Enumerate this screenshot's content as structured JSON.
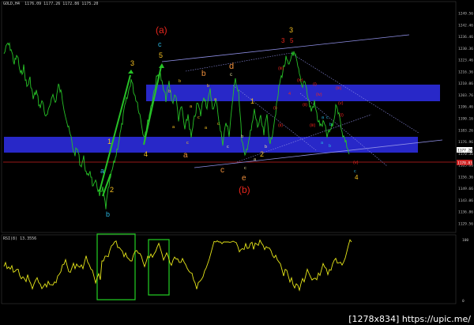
{
  "header": {
    "symbol_info": "GOLD,H4  1176.09 1177.26 1172.86 1175.20"
  },
  "rsi": {
    "title": "RSI(8) 13.3556",
    "levels": [
      "100",
      "0"
    ]
  },
  "price_axis": {
    "labels": [
      "1249.56",
      "1242.46",
      "1236.46",
      "1230.36",
      "1223.46",
      "1216.36",
      "1210.06",
      "1203.76",
      "1196.46",
      "1190.16",
      "1183.26",
      "1176.96",
      "1170.36",
      "1163.86",
      "1156.36",
      "1149.66",
      "1143.06",
      "1136.86",
      "1129.56"
    ],
    "bid_tag": "1177.26",
    "ask_tag": "1170.83"
  },
  "labels": {
    "a_cycle": "(a)",
    "b_cycle": "(b)",
    "c_cyan": "c",
    "five_top": "5",
    "three_left": "3",
    "one": "1",
    "two": "2",
    "a_cyan": "a",
    "b_cyan": "b",
    "four_left": "4",
    "three_top": "3",
    "three_red": "3",
    "five_red": "5",
    "b_orange": "b",
    "d_orange": "d",
    "c_cream": "c",
    "a_orange": "a",
    "c_orange": "c",
    "e_orange": "e",
    "two_mid": "2",
    "one_mid": "1",
    "four_final": "4"
  },
  "footer": {
    "text": "[1278x834] https://upic.me/"
  },
  "colors": {
    "bg": "#000000",
    "band": "#2727c8",
    "price": "#27c227",
    "rsi": "#e6e619",
    "box": "#23d023",
    "trend": "#8f8fe6",
    "redline": "#d21e1e"
  }
}
